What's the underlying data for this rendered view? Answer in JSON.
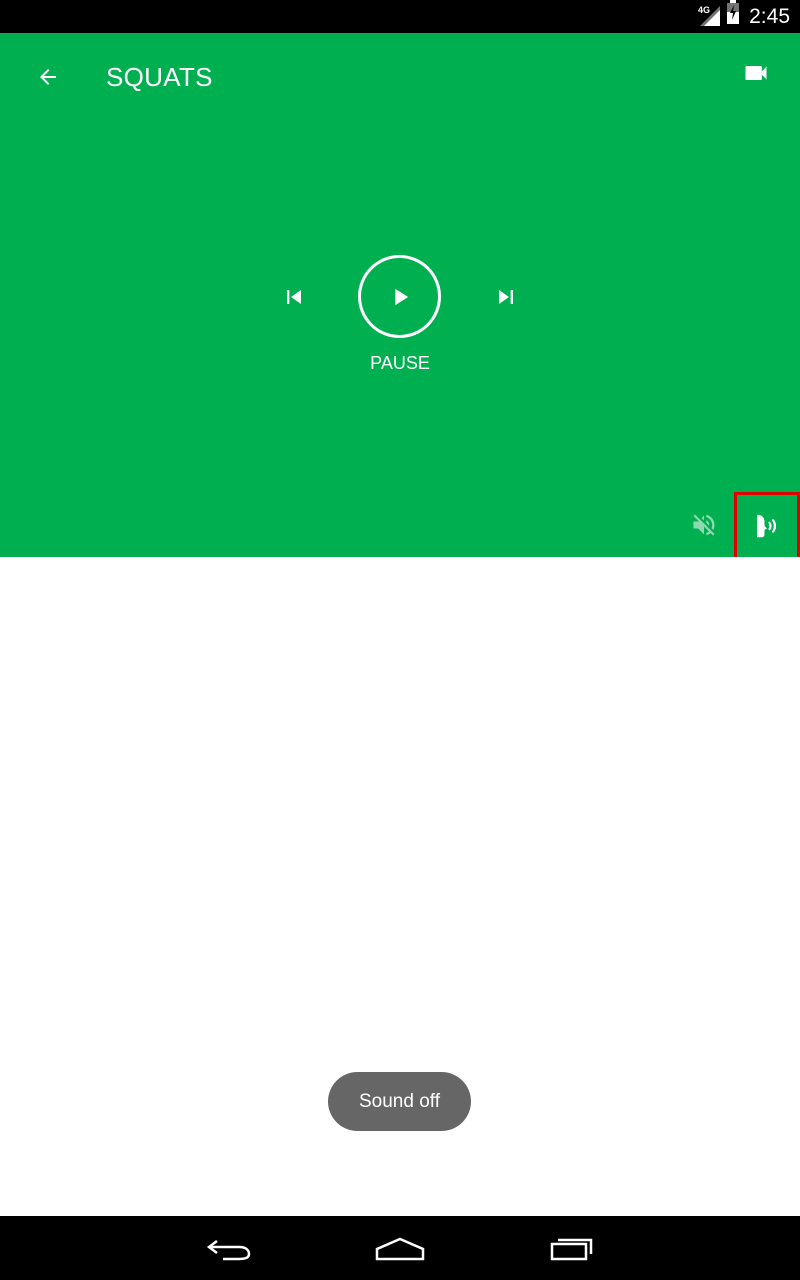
{
  "status_bar": {
    "time": "2:45",
    "network_label": "4G",
    "icons": [
      "signal-icon",
      "battery-icon"
    ]
  },
  "header": {
    "title": "SQUATS",
    "background_color": "#00B050",
    "icons": [
      "back-arrow-icon",
      "videocam-icon"
    ]
  },
  "player": {
    "state_label": "PAUSE",
    "icons": [
      "skip-previous-icon",
      "play-icon",
      "skip-next-icon"
    ]
  },
  "audio_controls": {
    "icons": [
      "volume-off-icon",
      "voice-coach-icon"
    ],
    "highlight_color": "#E00000"
  },
  "toast": {
    "text": "Sound off"
  },
  "nav_bar": {
    "icons": [
      "back-icon",
      "home-icon",
      "recents-icon"
    ]
  }
}
